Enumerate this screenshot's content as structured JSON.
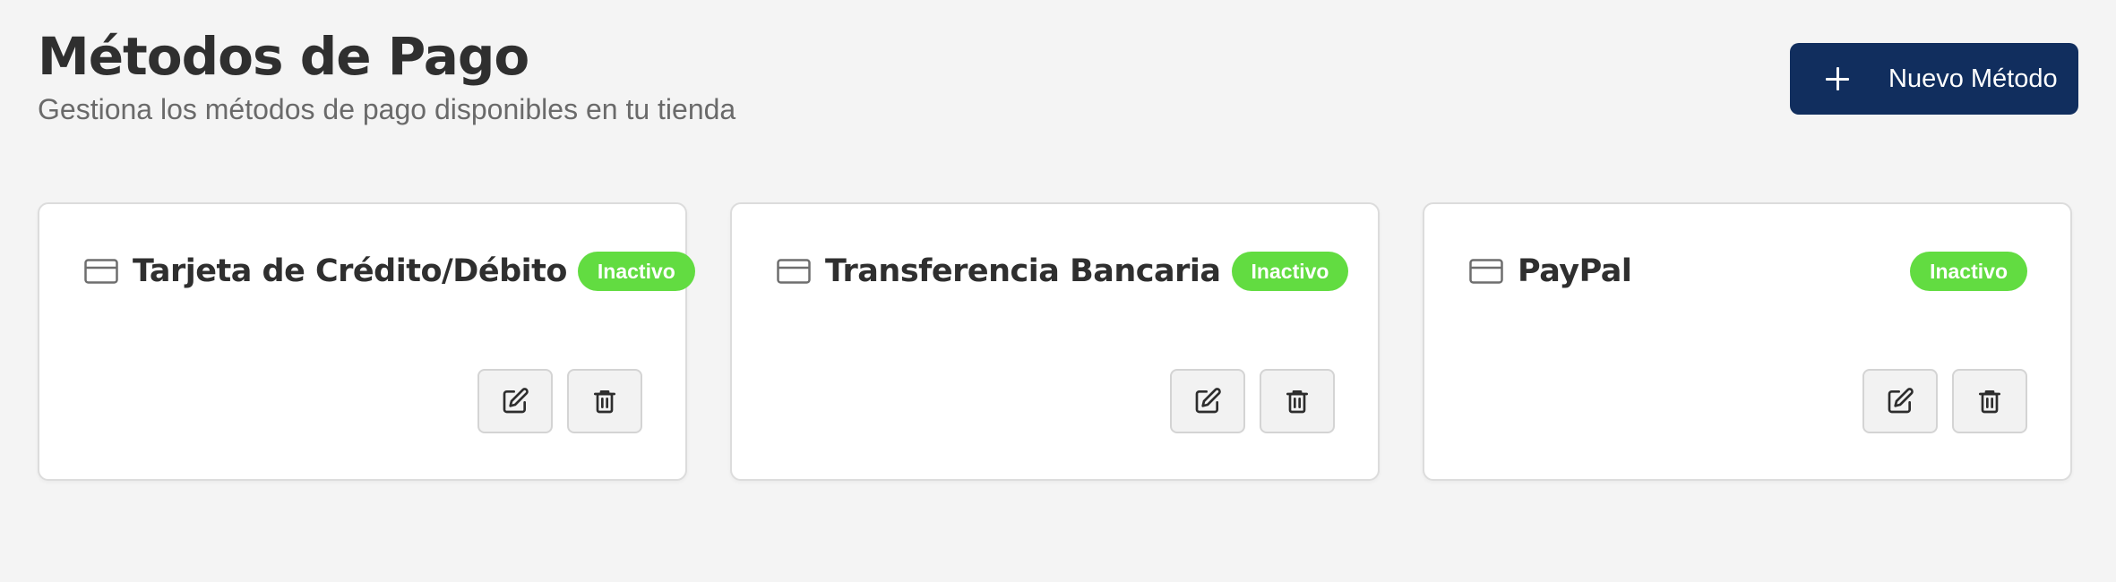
{
  "header": {
    "title": "Métodos de Pago",
    "subtitle": "Gestiona los métodos de pago disponibles en tu tienda",
    "new_button_label": "Nuevo Método",
    "new_button_icon": "plus-icon"
  },
  "colors": {
    "primary": "#112e5e",
    "badge_inactive": "#62dc41",
    "background": "#f4f4f4"
  },
  "payment_methods": [
    {
      "name": "Tarjeta de Crédito/Débito",
      "status": "Inactivo",
      "icon": "credit-card-icon"
    },
    {
      "name": "Transferencia Bancaria",
      "status": "Inactivo",
      "icon": "credit-card-icon"
    },
    {
      "name": "PayPal",
      "status": "Inactivo",
      "icon": "credit-card-icon"
    }
  ],
  "actions": {
    "edit_icon": "edit-icon",
    "delete_icon": "trash-icon"
  }
}
